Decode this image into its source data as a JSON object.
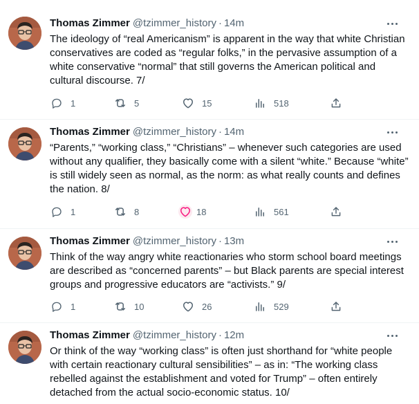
{
  "colors": {
    "text": "#0f1419",
    "secondary": "#536471",
    "divider": "#eff3f4",
    "like_hover": "#f91880"
  },
  "icons": {
    "reply": "reply-icon",
    "retweet": "retweet-icon",
    "like": "heart-icon",
    "views": "views-icon",
    "share": "share-icon",
    "more": "more-icon"
  },
  "tweets": [
    {
      "name": "Thomas Zimmer",
      "handle": "@tzimmer_history",
      "sep": "·",
      "time": "14m",
      "text": "The ideology of “real Americanism” is apparent in the way that white Christian conservatives are coded as “regular folks,” in the pervasive assumption of a white conservative “normal” that still governs the American political and cultural discourse. 7/",
      "replies": "1",
      "retweets": "5",
      "likes": "15",
      "views": "518"
    },
    {
      "name": "Thomas Zimmer",
      "handle": "@tzimmer_history",
      "sep": "·",
      "time": "14m",
      "text": "“Parents,” “working class,” “Christians” – whenever such categories are used without any qualifier, they basically come with a silent “white.” Because “white” is still widely seen as normal, as the norm: as what really counts and defines the nation. 8/",
      "replies": "1",
      "retweets": "8",
      "likes": "18",
      "views": "561"
    },
    {
      "name": "Thomas Zimmer",
      "handle": "@tzimmer_history",
      "sep": "·",
      "time": "13m",
      "text": "Think of the way angry white reactionaries who storm school board meetings are described as “concerned parents” – but Black parents are special interest groups and progressive educators are “activists.” 9/",
      "replies": "1",
      "retweets": "10",
      "likes": "26",
      "views": "529"
    },
    {
      "name": "Thomas Zimmer",
      "handle": "@tzimmer_history",
      "sep": "·",
      "time": "12m",
      "text": "Or think of the way “working class” is often just shorthand for “white people with certain reactionary cultural sensibilities” – as in: “The working class rebelled against the establishment and voted for Trump” – often entirely detached from the actual socio-economic status. 10/"
    }
  ]
}
